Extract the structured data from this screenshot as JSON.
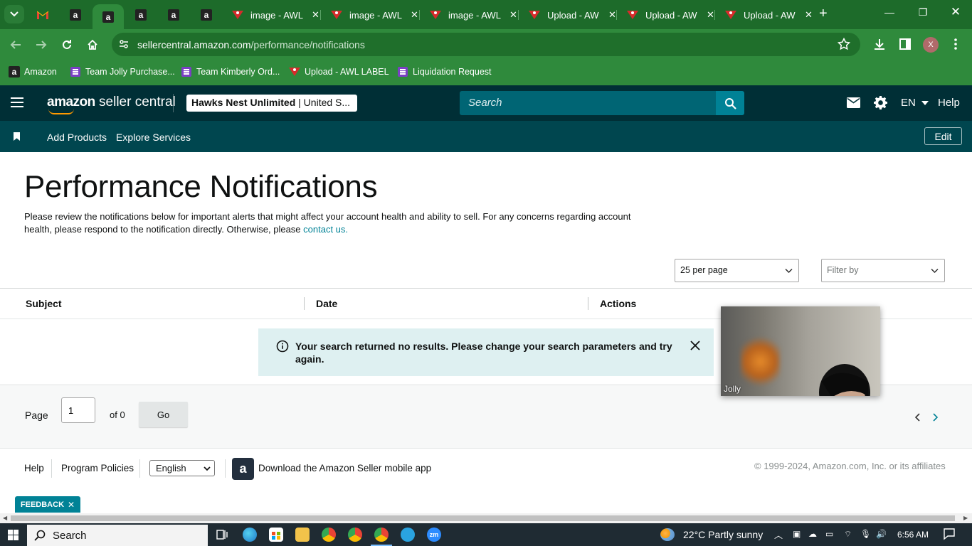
{
  "browser": {
    "tabs": [
      {
        "kind": "pinned",
        "icon": "gmail-icon"
      },
      {
        "kind": "pinned",
        "icon": "amazon-icon"
      },
      {
        "kind": "pinned",
        "icon": "amazon-icon",
        "active": true
      },
      {
        "kind": "pinned",
        "icon": "amazon-icon"
      },
      {
        "kind": "pinned",
        "icon": "amazon-icon"
      },
      {
        "kind": "pinned",
        "icon": "amazon-icon"
      },
      {
        "kind": "tab",
        "title": "image - AWL"
      },
      {
        "kind": "tab",
        "title": "image - AWL"
      },
      {
        "kind": "tab",
        "title": "image - AWL"
      },
      {
        "kind": "tab",
        "title": "Upload - AW"
      },
      {
        "kind": "tab",
        "title": "Upload - AW"
      },
      {
        "kind": "tab",
        "title": "Upload - AW"
      }
    ],
    "url_domain": "sellercentral.amazon.com",
    "url_path": "/performance/notifications",
    "profile_initial": "X",
    "bookmarks": [
      {
        "label": "Amazon",
        "icon": "amazon-icon"
      },
      {
        "label": "Team Jolly Purchase...",
        "icon": "list-icon"
      },
      {
        "label": "Team Kimberly Ord...",
        "icon": "list-icon"
      },
      {
        "label": "Upload - AWL LABEL",
        "icon": "awl-icon"
      },
      {
        "label": "Liquidation Request",
        "icon": "list-icon"
      }
    ]
  },
  "header": {
    "logo_text_bold": "amazon",
    "logo_text": "seller central",
    "store_name": "Hawks Nest Unlimited",
    "store_region": "| United S...",
    "search_placeholder": "Search",
    "language": "EN",
    "help": "Help"
  },
  "subnav": {
    "items": [
      "Add Products",
      "Explore Services"
    ],
    "edit": "Edit"
  },
  "page": {
    "title": "Performance Notifications",
    "intro": "Please review the notifications below for important alerts that might affect your account health and ability to sell. For any concerns regarding account health, please respond to the notification directly. Otherwise, please ",
    "contact_link": "contact us.",
    "per_page": "25 per page",
    "filter_placeholder": "Filter by",
    "columns": [
      "Subject",
      "Date",
      "Actions"
    ],
    "alert_message": "Your search returned no results. Please change your search parameters and try again.",
    "pagination": {
      "page_label": "Page",
      "page_value": "1",
      "of_label": "of 0",
      "go": "Go"
    }
  },
  "footer": {
    "help": "Help",
    "program_policies": "Program Policies",
    "language": "English",
    "app_download": "Download the Amazon Seller mobile app",
    "copyright": "© 1999-2024, Amazon.com, Inc. or its affiliates"
  },
  "feedback": "FEEDBACK",
  "video": {
    "participant": "Jolly"
  },
  "taskbar": {
    "search": "Search",
    "weather": "22°C  Partly sunny",
    "time": "6:56 AM"
  },
  "colors": {
    "browser_frame": "#2f8a3c",
    "sc_header": "#002f36",
    "sc_subnav": "#00464f",
    "accent": "#008296",
    "alert_bg": "#def0f1"
  }
}
